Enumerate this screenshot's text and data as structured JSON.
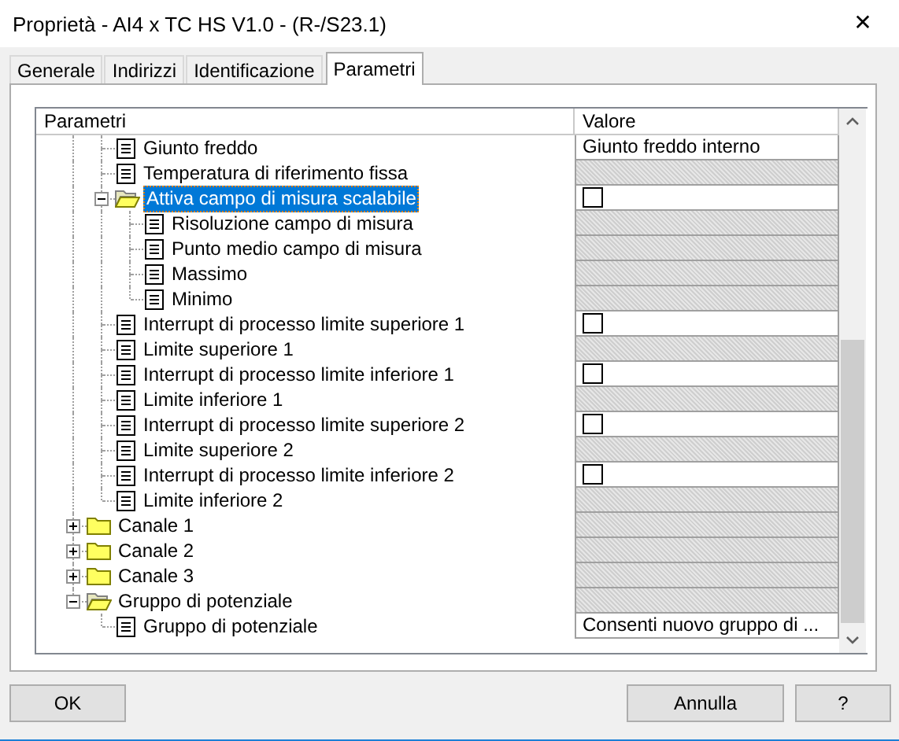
{
  "window": {
    "title": "Proprietà - AI4 x TC HS V1.0 - (R-/S23.1)",
    "close": "✕"
  },
  "tabs": [
    {
      "label": "Generale",
      "selected": false
    },
    {
      "label": "Indirizzi",
      "selected": false
    },
    {
      "label": "Identificazione",
      "selected": false
    },
    {
      "label": "Parametri",
      "selected": true
    }
  ],
  "tree": {
    "columns": [
      "Parametri",
      "Valore"
    ],
    "items": [
      {
        "kind": "cut",
        "children": [
          {
            "kind": "param",
            "label": "Giunto freddo",
            "selected": false,
            "value": {
              "kind": "text",
              "text": "Giunto freddo interno"
            }
          },
          {
            "kind": "param",
            "label": "Temperatura di riferimento fissa",
            "selected": false
          },
          {
            "kind": "folder",
            "label": "Attiva campo di misura scalabile",
            "selected": true,
            "expanded": true,
            "value": {
              "kind": "checkbox",
              "checked": false
            },
            "children": [
              {
                "kind": "param",
                "label": "Risoluzione campo di misura",
                "selected": false
              },
              {
                "kind": "param",
                "label": "Punto medio campo di misura",
                "selected": false
              },
              {
                "kind": "param",
                "label": "Massimo",
                "selected": false
              },
              {
                "kind": "param",
                "label": "Minimo",
                "selected": false
              }
            ]
          },
          {
            "kind": "param",
            "label": "Interrupt di processo limite superiore 1",
            "selected": false,
            "value": {
              "kind": "checkbox",
              "checked": false
            }
          },
          {
            "kind": "param",
            "label": "Limite superiore 1",
            "selected": false
          },
          {
            "kind": "param",
            "label": "Interrupt di processo limite inferiore 1",
            "selected": false,
            "value": {
              "kind": "checkbox",
              "checked": false
            }
          },
          {
            "kind": "param",
            "label": "Limite inferiore 1",
            "selected": false
          },
          {
            "kind": "param",
            "label": "Interrupt di processo limite superiore 2",
            "selected": false,
            "value": {
              "kind": "checkbox",
              "checked": false
            }
          },
          {
            "kind": "param",
            "label": "Limite superiore 2",
            "selected": false
          },
          {
            "kind": "param",
            "label": "Interrupt di processo limite inferiore 2",
            "selected": false,
            "value": {
              "kind": "checkbox",
              "checked": false
            }
          },
          {
            "kind": "param",
            "label": "Limite inferiore 2",
            "selected": false
          }
        ]
      },
      {
        "kind": "folder",
        "label": "Canale 1",
        "selected": false,
        "expanded": false
      },
      {
        "kind": "folder",
        "label": "Canale 2",
        "selected": false,
        "expanded": false
      },
      {
        "kind": "folder",
        "label": "Canale 3",
        "selected": false,
        "expanded": false
      },
      {
        "kind": "folder",
        "label": "Gruppo di potenziale",
        "selected": false,
        "expanded": true,
        "children": [
          {
            "kind": "param",
            "label": "Gruppo di potenziale",
            "selected": false,
            "value": {
              "kind": "text",
              "text": "Consenti nuovo gruppo di ..."
            }
          }
        ]
      }
    ]
  },
  "buttons": [
    {
      "label": "OK"
    },
    {
      "label": "Annulla"
    },
    {
      "label": "?"
    }
  ]
}
